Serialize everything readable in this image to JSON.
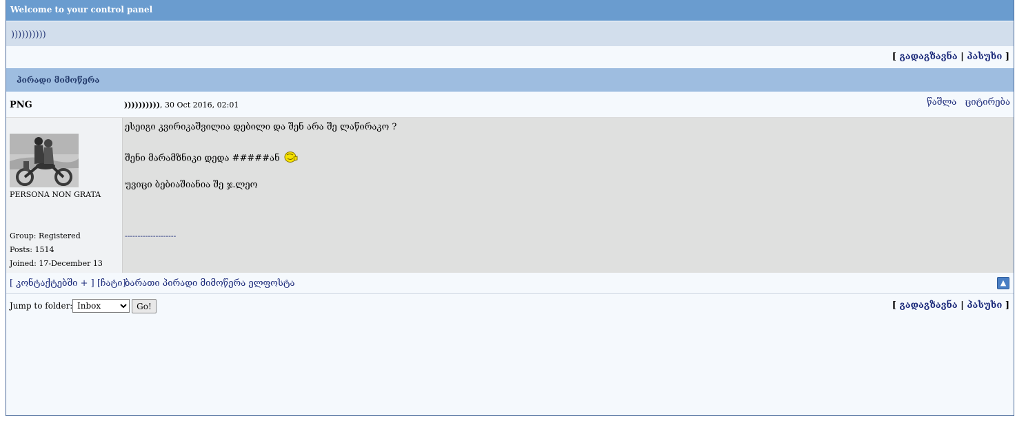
{
  "header": {
    "title": "Welcome to your control panel"
  },
  "subheader": {
    "text": "))))))))))"
  },
  "actions": {
    "forward": "გადაგზავნა",
    "reply": "პასუხი",
    "open": "[ ",
    "sep": " | ",
    "close": " ]"
  },
  "section": {
    "title": "პირადი მიმოწერა"
  },
  "post": {
    "author": "PNG",
    "title_prefix": "))))))))))",
    "date": ", 30 Oct 2016, 02:01",
    "delete_label": "წაშლა",
    "quote_label": "ციტირება",
    "member_title": "PERSONA NON GRATA",
    "group": "Group: Registered",
    "posts": "Posts: 1514",
    "joined": "Joined: 17-December 13",
    "lines": [
      "ესეიგი კვირიკაშვილია დებილი და შენ არა შე ლაწირაკო ?",
      "შენი მარამზნიკი დედა #####ან",
      "უვიცი ბებიაშიანია შე ჯ.ლეო"
    ],
    "signature_divider": "--------------------",
    "emoticon": "smiley-icon"
  },
  "footer": {
    "contacts_open": "[ ",
    "contacts_label": "კონტაქტებში +",
    "contacts_close": " ]",
    "chat_label": "[ჩატი]",
    "print_label": "ბარათი პირადი მიმოწერა ელფოსტა",
    "top_icon": "arrow-up-icon"
  },
  "jump": {
    "label": "Jump to folder:",
    "selected": "Inbox",
    "go": "Go!"
  },
  "colors": {
    "header_bg": "#6a9ccf",
    "section_bg": "#9ebde0",
    "link": "#1b2a7a"
  }
}
